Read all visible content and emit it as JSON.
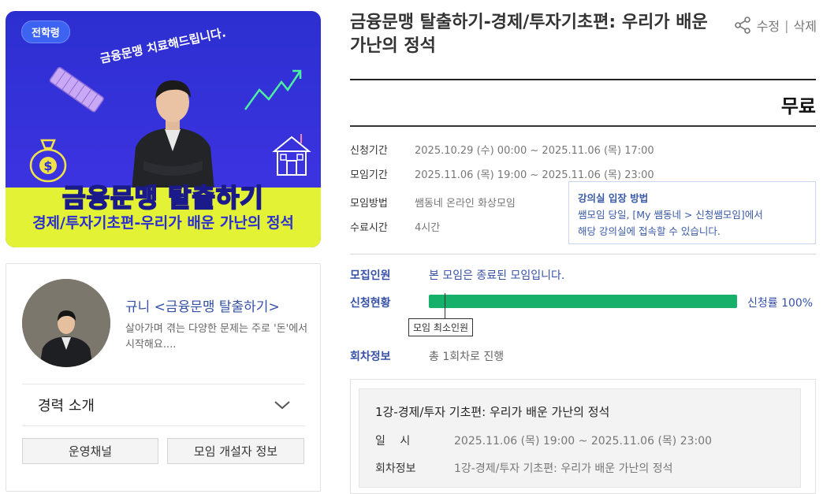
{
  "banner": {
    "badge": "전학령",
    "tagline": "금융문맹 치료해드립니다.",
    "title": "금융문맹 탈출하기",
    "subtitle": "경제/투자기초편-우리가 배운 가난의 정석",
    "colors": {
      "background": "#2c2fd0",
      "band": "#e4f236",
      "title": "#ff7fb2"
    }
  },
  "host": {
    "name": "규니 <금융문맹 탈출하기>",
    "description": "살아가며 겪는 다양한 문제는 주로 '돈'에서 시작해요....",
    "career_label": "경력 소개",
    "channel_button": "운영채널",
    "hostinfo_button": "모임 개설자 정보"
  },
  "meeting": {
    "title": "금융문맹 탈출하기-경제/투자기초편: 우리가 배운 가난의 정석",
    "actions": {
      "edit": "수정",
      "separator": "|",
      "delete": "삭제"
    },
    "price": "무료",
    "info": [
      {
        "key": "신청기간",
        "value": "2025.10.29 (수) 00:00 ~ 2025.11.06 (목) 17:00"
      },
      {
        "key": "모임기간",
        "value": "2025.11.06 (목) 19:00 ~ 2025.11.06 (목) 23:00"
      },
      {
        "key": "모임방법",
        "value": "쌤동네 온라인 화상모임"
      },
      {
        "key": "수료시간",
        "value": "4시간"
      }
    ],
    "tip": {
      "title": "강의실 입장 방법",
      "line1": "쌤모임 당일, [My 쌤동네 > 신청쌤모임]에서",
      "line2": "해당 강의실에 접속할 수 있습니다."
    },
    "recruit": {
      "key": "모집인원",
      "value": "본 모임은 종료된 모임입니다."
    },
    "status": {
      "key": "신청현황",
      "rate_text": "신청률 100%",
      "rate": 1.0,
      "min_label": "모임 최소인원",
      "min_fraction": 0.05
    },
    "sessions": {
      "key": "회차정보",
      "value": "총 1회차로 진행"
    },
    "session_detail": {
      "title": "1강-경제/투자 기초편: 우리가 배운 가난의 정석",
      "rows": [
        {
          "key": "일　 시",
          "value": "2025.11.06 (목) 19:00 ~ 2025.11.06 (목) 23:00"
        },
        {
          "key": "회차정보",
          "value": "1강-경제/투자 기초편: 우리가 배운 가난의 정석"
        }
      ]
    },
    "colors": {
      "accent": "#3650a8",
      "progress": "#17b06b"
    }
  }
}
